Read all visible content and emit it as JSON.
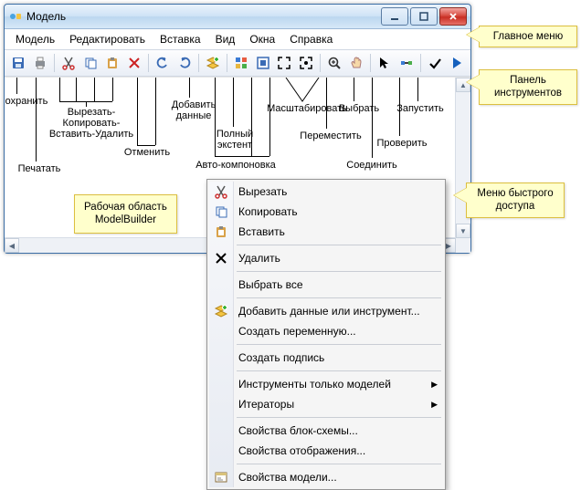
{
  "window": {
    "title": "Модель"
  },
  "menu": {
    "items": [
      "Модель",
      "Редактировать",
      "Вставка",
      "Вид",
      "Окна",
      "Справка"
    ]
  },
  "toolbar_icons": [
    "save-icon",
    "print-icon",
    "sep",
    "cut-icon",
    "copy-icon",
    "paste-icon",
    "delete-icon",
    "sep",
    "undo-icon",
    "redo-icon",
    "sep",
    "add-data-icon",
    "sep",
    "auto-layout-icon",
    "full-extent-icon",
    "fit-icon",
    "zoom-extent-icon",
    "sep",
    "zoom-in-icon",
    "pan-icon",
    "sep",
    "select-icon",
    "connect-icon",
    "sep",
    "validate-icon",
    "run-icon"
  ],
  "annotations": {
    "save": "Сохранить",
    "print": "Печатать",
    "cut_copy_paste_delete": "Вырезать-\nКопировать-\nВставить-Удалить",
    "undo": "Отменить",
    "add_data": "Добавить\nданные",
    "auto_layout": "Авто-компоновка",
    "full_extent": "Полный\nэкстент",
    "zoom": "Масштабировать",
    "move": "Переместить",
    "select": "Выбрать",
    "connect": "Соединить",
    "validate": "Проверить",
    "run": "Запустить"
  },
  "workarea": "Рабочая область\nModelBuilder",
  "callouts": {
    "main_menu": "Главное меню",
    "toolbar": "Панель\nинструментов",
    "context": "Меню быстрого\nдоступа"
  },
  "context_menu": [
    {
      "icon": "cut-icon",
      "label": "Вырезать"
    },
    {
      "icon": "copy-icon",
      "label": "Копировать"
    },
    {
      "icon": "paste-icon",
      "label": "Вставить"
    },
    {
      "sep": true
    },
    {
      "icon": "delete-x-icon",
      "label": "Удалить"
    },
    {
      "sep": true
    },
    {
      "icon": null,
      "label": "Выбрать все"
    },
    {
      "sep": true
    },
    {
      "icon": "add-data-icon",
      "label": "Добавить данные или инструмент..."
    },
    {
      "icon": null,
      "label": "Создать переменную..."
    },
    {
      "sep": true
    },
    {
      "icon": null,
      "label": "Создать подпись"
    },
    {
      "sep": true
    },
    {
      "icon": null,
      "label": "Инструменты только моделей",
      "sub": true
    },
    {
      "icon": null,
      "label": "Итераторы",
      "sub": true
    },
    {
      "sep": true
    },
    {
      "icon": null,
      "label": "Свойства блок-схемы..."
    },
    {
      "icon": null,
      "label": "Свойства отображения..."
    },
    {
      "sep": true
    },
    {
      "icon": "properties-icon",
      "label": "Свойства модели..."
    }
  ]
}
